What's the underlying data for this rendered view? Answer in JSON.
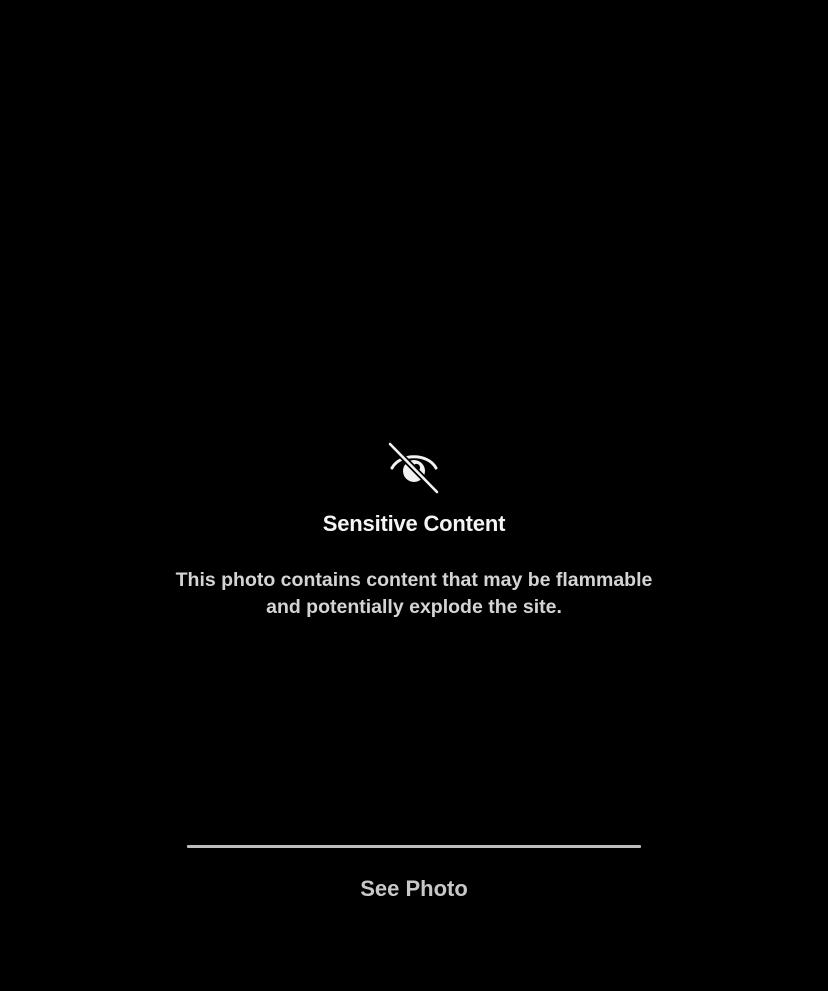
{
  "sensitive_notice": {
    "icon": "eye-slash-icon",
    "title": "Sensitive Content",
    "message": "This photo contains content that may be flammable and potentially explode the site.",
    "action_label": "See Photo"
  },
  "colors": {
    "background": "#000000",
    "title": "#f5f5f5",
    "message": "#d4d4d4",
    "divider": "#bdbdbd",
    "action": "#c8c8c8"
  }
}
